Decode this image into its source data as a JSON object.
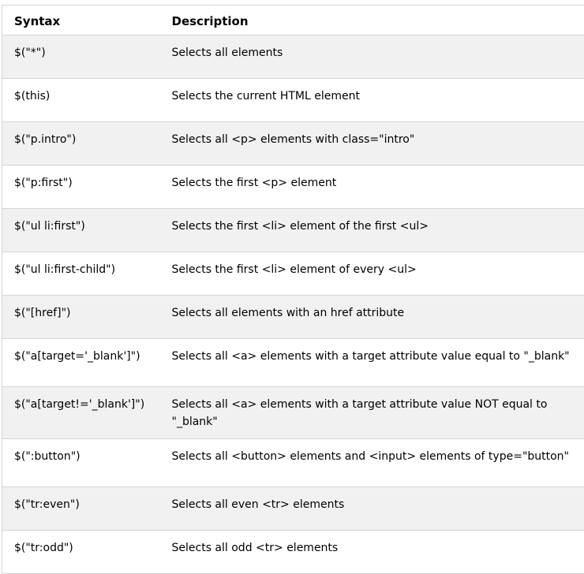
{
  "header": {
    "syntax": "Syntax",
    "description": "Description"
  },
  "rows": [
    {
      "syntax": "$(\"*\")",
      "description": "Selects all elements"
    },
    {
      "syntax": "$(this)",
      "description": "Selects the current HTML element"
    },
    {
      "syntax": "$(\"p.intro\")",
      "description": "Selects all <p> elements with class=\"intro\""
    },
    {
      "syntax": "$(\"p:first\")",
      "description": "Selects the first <p> element"
    },
    {
      "syntax": "$(\"ul li:first\")",
      "description": "Selects the first <li> element of the first <ul>"
    },
    {
      "syntax": "$(\"ul li:first-child\")",
      "description": "Selects the first <li> element of every <ul>"
    },
    {
      "syntax": "$(\"[href]\")",
      "description": "Selects all elements with an href attribute"
    },
    {
      "syntax": "$(\"a[target='_blank']\")",
      "description": "Selects all <a> elements with a target attribute value equal to \"_blank\""
    },
    {
      "syntax": "$(\"a[target!='_blank']\")",
      "description": "Selects all <a> elements with a target attribute value NOT equal to \"_blank\""
    },
    {
      "syntax": "$(\":button\")",
      "description": "Selects all <button> elements and <input> elements of type=\"button\""
    },
    {
      "syntax": "$(\"tr:even\")",
      "description": "Selects all even <tr> elements"
    },
    {
      "syntax": "$(\"tr:odd\")",
      "description": "Selects all odd <tr> elements"
    }
  ]
}
